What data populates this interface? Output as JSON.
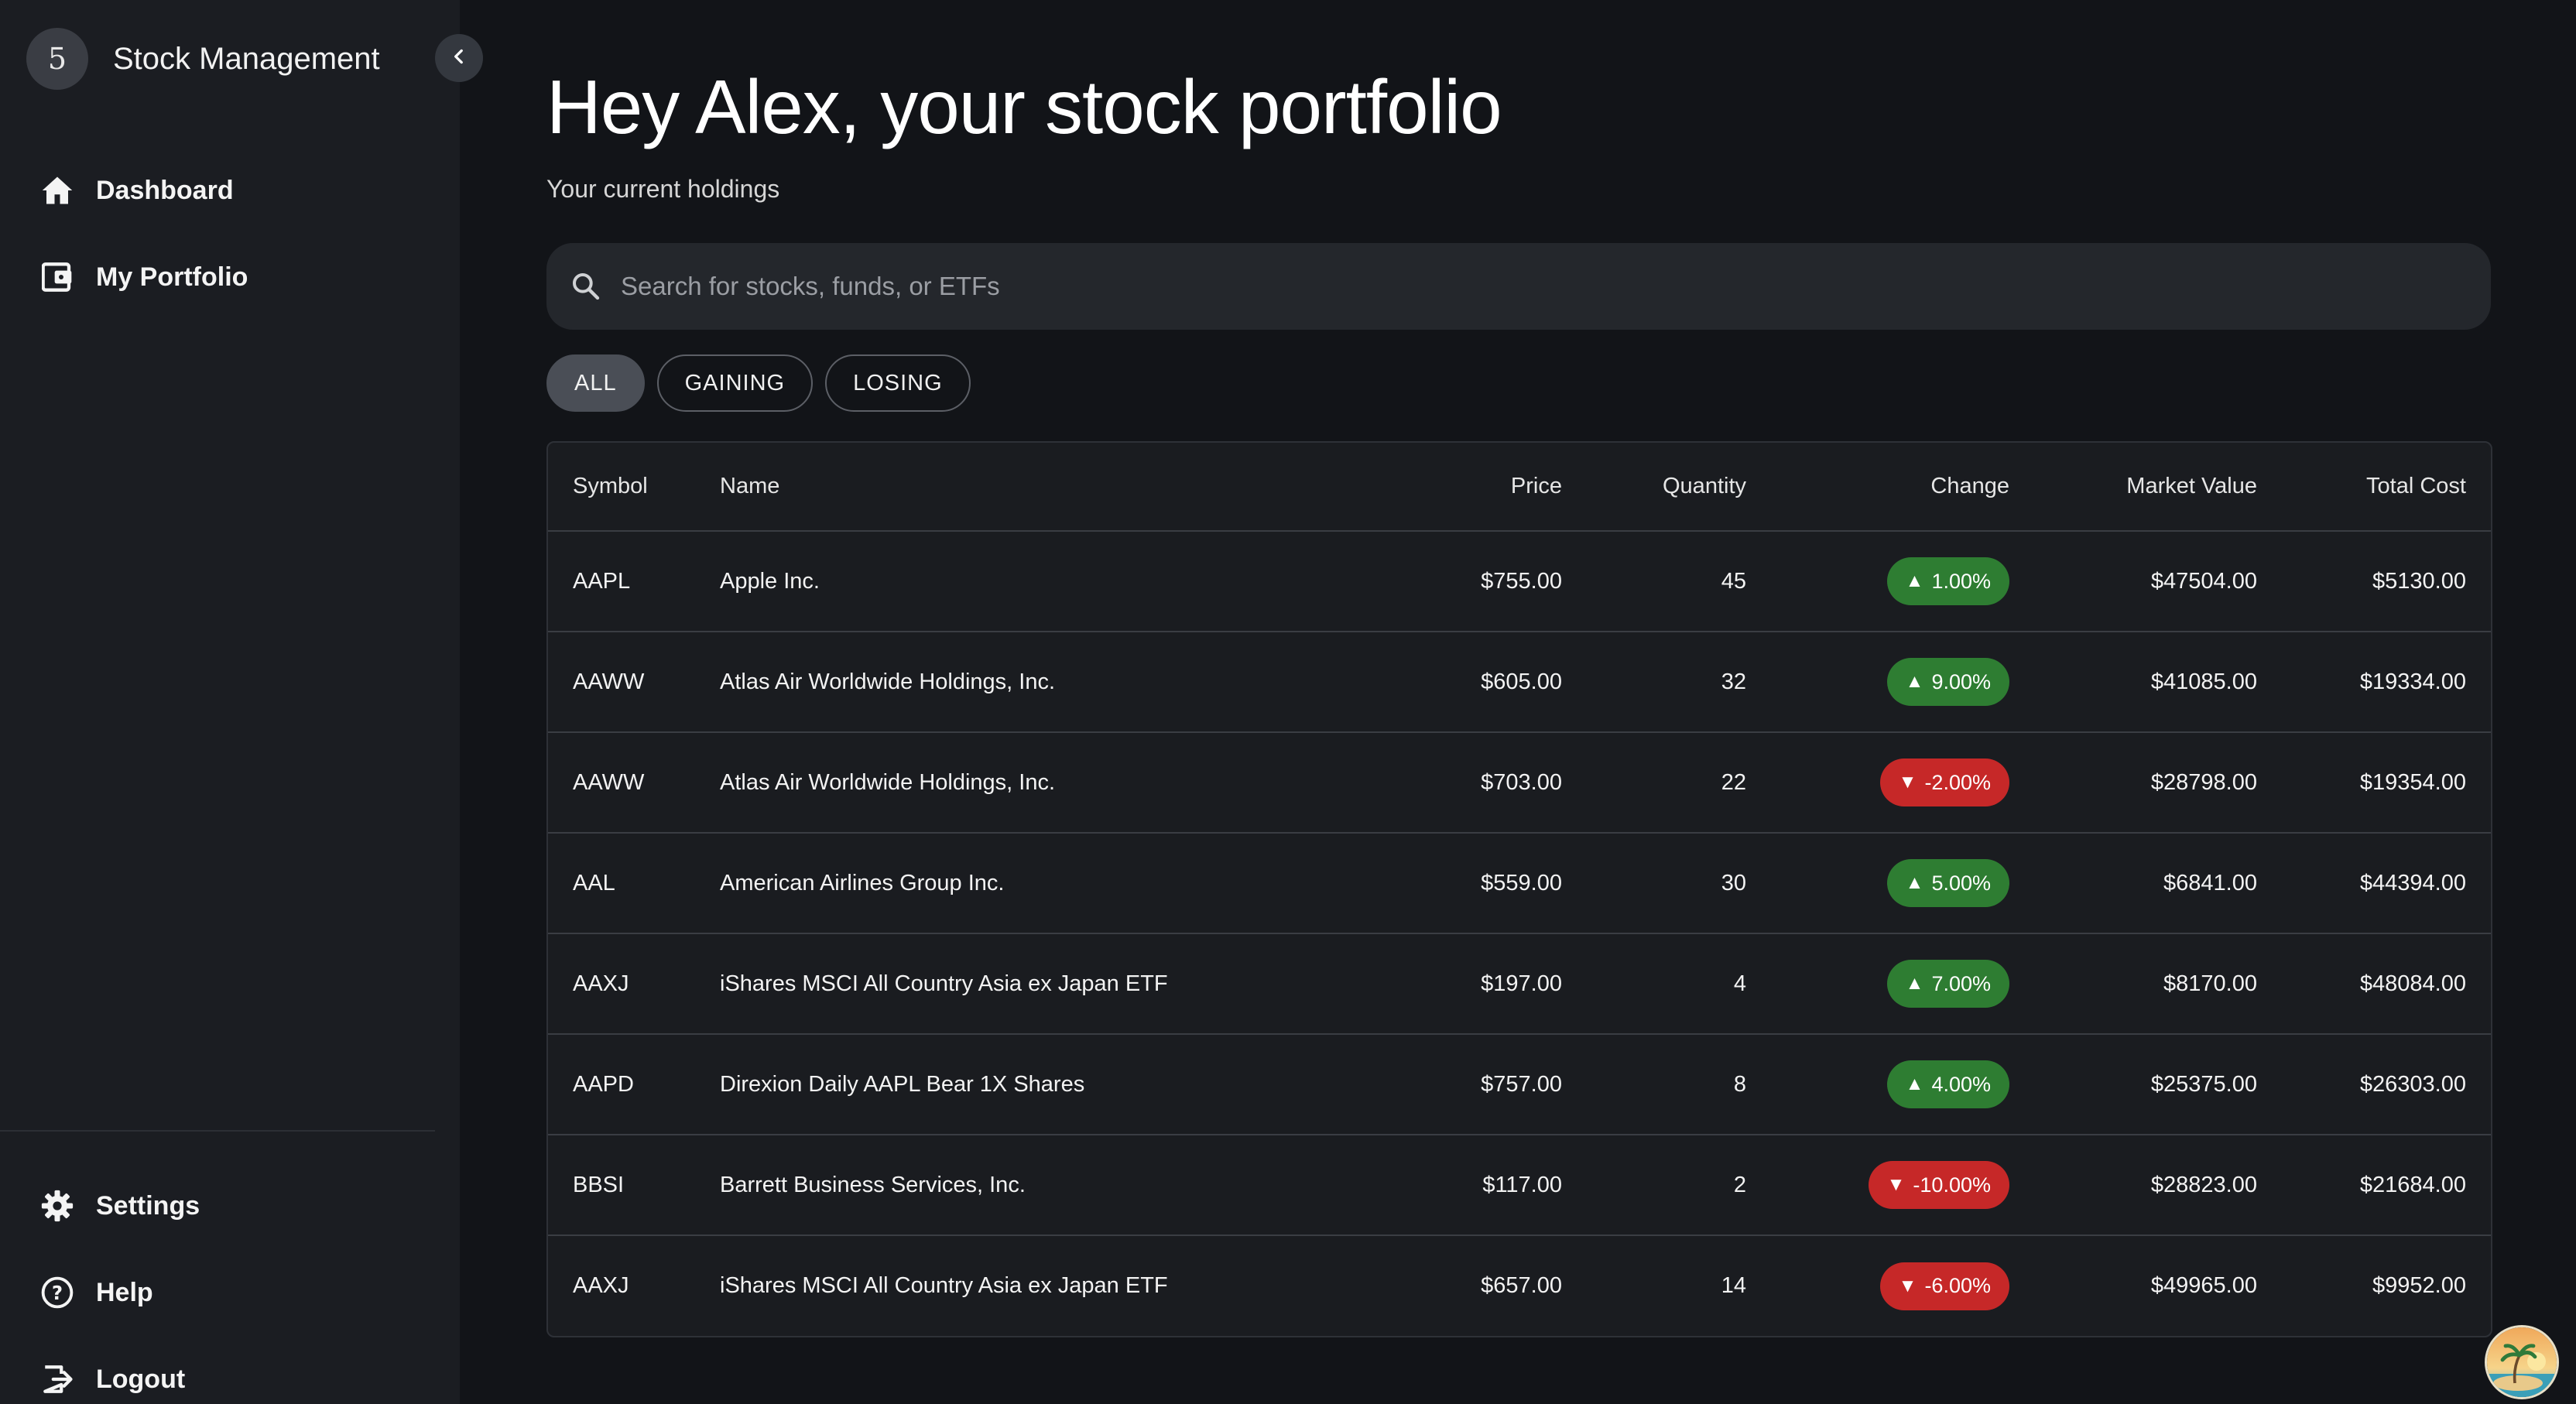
{
  "brand": {
    "logo_text": "5",
    "title": "Stock Management"
  },
  "nav": {
    "top": [
      {
        "label": "Dashboard",
        "icon": "home-icon"
      },
      {
        "label": "My Portfolio",
        "icon": "wallet-icon"
      }
    ],
    "bottom": [
      {
        "label": "Settings",
        "icon": "gear-icon"
      },
      {
        "label": "Help",
        "icon": "help-icon"
      },
      {
        "label": "Logout",
        "icon": "logout-icon"
      }
    ]
  },
  "header": {
    "title": "Hey Alex, your stock portfolio",
    "subtitle": "Your current holdings"
  },
  "search": {
    "placeholder": "Search for stocks, funds, or ETFs",
    "value": ""
  },
  "filters": [
    "ALL",
    "GAINING",
    "LOSING"
  ],
  "active_filter": "ALL",
  "table": {
    "columns": [
      "Symbol",
      "Name",
      "Price",
      "Quantity",
      "Change",
      "Market Value",
      "Total Cost"
    ],
    "rows": [
      {
        "symbol": "AAPL",
        "name": "Apple Inc.",
        "price": "$755.00",
        "quantity": "45",
        "change": "1.00%",
        "direction": "up",
        "market_value": "$47504.00",
        "total_cost": "$5130.00"
      },
      {
        "symbol": "AAWW",
        "name": "Atlas Air Worldwide Holdings, Inc.",
        "price": "$605.00",
        "quantity": "32",
        "change": "9.00%",
        "direction": "up",
        "market_value": "$41085.00",
        "total_cost": "$19334.00"
      },
      {
        "symbol": "AAWW",
        "name": "Atlas Air Worldwide Holdings, Inc.",
        "price": "$703.00",
        "quantity": "22",
        "change": "-2.00%",
        "direction": "down",
        "market_value": "$28798.00",
        "total_cost": "$19354.00"
      },
      {
        "symbol": "AAL",
        "name": "American Airlines Group Inc.",
        "price": "$559.00",
        "quantity": "30",
        "change": "5.00%",
        "direction": "up",
        "market_value": "$6841.00",
        "total_cost": "$44394.00"
      },
      {
        "symbol": "AAXJ",
        "name": "iShares MSCI All Country Asia ex Japan ETF",
        "price": "$197.00",
        "quantity": "4",
        "change": "7.00%",
        "direction": "up",
        "market_value": "$8170.00",
        "total_cost": "$48084.00"
      },
      {
        "symbol": "AAPD",
        "name": "Direxion Daily AAPL Bear 1X Shares",
        "price": "$757.00",
        "quantity": "8",
        "change": "4.00%",
        "direction": "up",
        "market_value": "$25375.00",
        "total_cost": "$26303.00"
      },
      {
        "symbol": "BBSI",
        "name": "Barrett Business Services, Inc.",
        "price": "$117.00",
        "quantity": "2",
        "change": "-10.00%",
        "direction": "down",
        "market_value": "$28823.00",
        "total_cost": "$21684.00"
      },
      {
        "symbol": "AAXJ",
        "name": "iShares MSCI All Country Asia ex Japan ETF",
        "price": "$657.00",
        "quantity": "14",
        "change": "-6.00%",
        "direction": "down",
        "market_value": "$49965.00",
        "total_cost": "$9952.00"
      }
    ]
  },
  "colors": {
    "background": "#121418",
    "sidebar": "#1b1d22",
    "gain": "#2e7d32",
    "loss": "#c62828"
  }
}
